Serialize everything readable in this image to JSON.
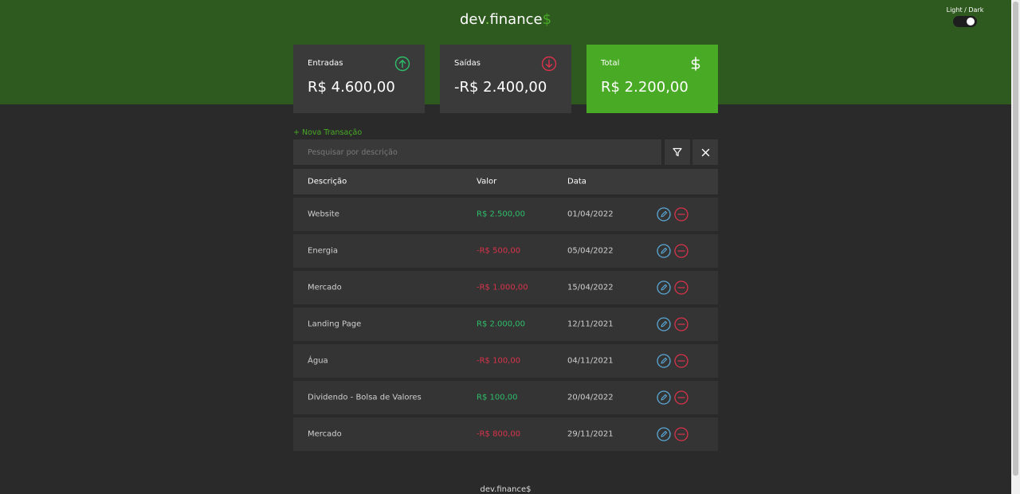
{
  "header": {
    "logo_prefix": "dev",
    "logo_dot": ".",
    "logo_name": "finance",
    "logo_dollar": "$",
    "theme_label": "Light / Dark"
  },
  "cards": {
    "income": {
      "title": "Entradas",
      "amount": "R$ 4.600,00",
      "icon": "arrow-up-circle-icon"
    },
    "expense": {
      "title": "Saídas",
      "amount": "-R$ 2.400,00",
      "icon": "arrow-down-circle-icon"
    },
    "total": {
      "title": "Total",
      "amount": "R$ 2.200,00",
      "icon": "dollar-icon"
    }
  },
  "actions": {
    "new_transaction": "+ Nova Transação",
    "search_placeholder": "Pesquisar por descrição"
  },
  "table": {
    "headers": [
      "Descrição",
      "Valor",
      "Data"
    ],
    "rows": [
      {
        "description": "Website",
        "value": "R$ 2.500,00",
        "date": "01/04/2022",
        "type": "pos"
      },
      {
        "description": "Energia",
        "value": "-R$ 500,00",
        "date": "05/04/2022",
        "type": "neg"
      },
      {
        "description": "Mercado",
        "value": "-R$ 1.000,00",
        "date": "15/04/2022",
        "type": "neg"
      },
      {
        "description": "Landing Page",
        "value": "R$ 2.000,00",
        "date": "12/11/2021",
        "type": "pos"
      },
      {
        "description": "Água",
        "value": "-R$ 100,00",
        "date": "04/11/2021",
        "type": "neg"
      },
      {
        "description": "Dividendo - Bolsa de Valores",
        "value": "R$ 100,00",
        "date": "20/04/2022",
        "type": "pos"
      },
      {
        "description": "Mercado",
        "value": "-R$ 800,00",
        "date": "29/11/2021",
        "type": "neg"
      }
    ]
  },
  "footer": {
    "text": "dev.finance$"
  },
  "colors": {
    "header_bg": "#2f5a1f",
    "page_bg": "#2a2a2a",
    "accent_green": "#49aa26",
    "positive": "#2dbf6a",
    "negative": "#d9334b",
    "edit_blue": "#5aa8d6"
  }
}
